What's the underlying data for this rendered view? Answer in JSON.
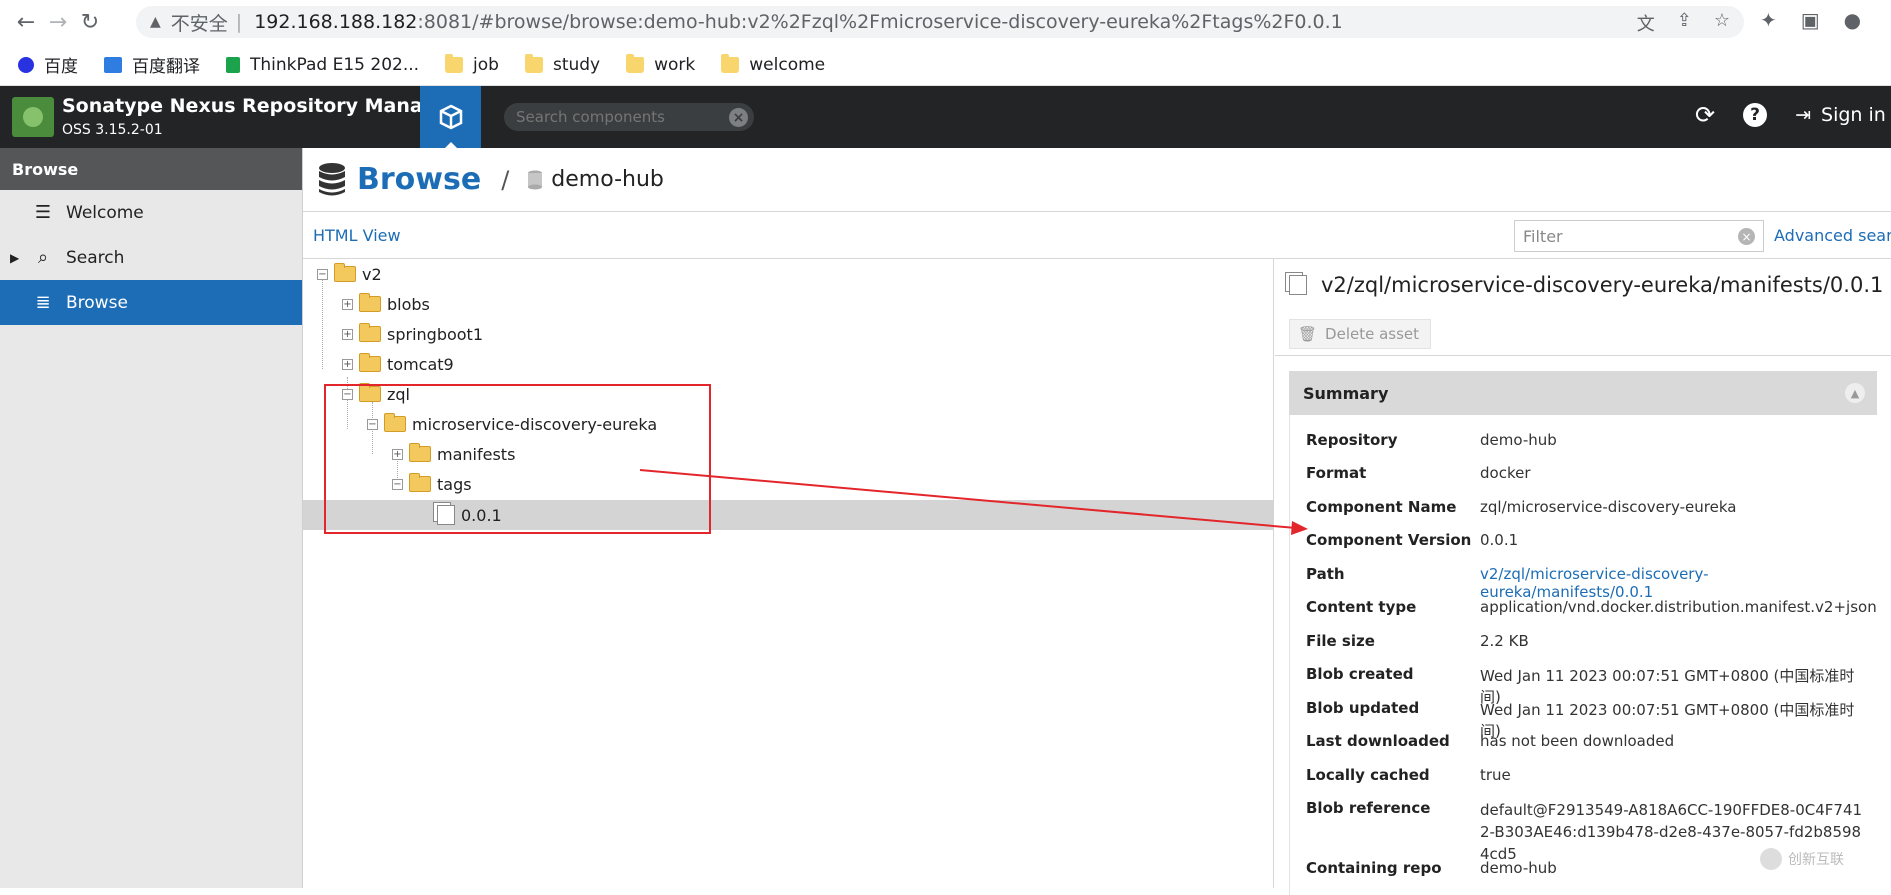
{
  "browser": {
    "insecure_label": "不安全",
    "url_host": "192.168.188.182",
    "url_path": ":8081/#browse/browse:demo-hub:v2%2Fzql%2Fmicroservice-discovery-eureka%2Ftags%2F0.0.1"
  },
  "bookmarks": [
    {
      "label": "百度",
      "color": "#2932e1"
    },
    {
      "label": "百度翻译",
      "color": "#2f7de1"
    },
    {
      "label": "ThinkPad E15 202...",
      "color": "#1aa34a"
    },
    {
      "label": "job",
      "color": "#f8d66d"
    },
    {
      "label": "study",
      "color": "#f8d66d"
    },
    {
      "label": "work",
      "color": "#f8d66d"
    },
    {
      "label": "welcome",
      "color": "#f8d66d"
    }
  ],
  "header": {
    "title": "Sonatype Nexus Repository Manager",
    "version": "OSS 3.15.2-01",
    "search_placeholder": "Search components",
    "signin_label": "Sign in"
  },
  "leftnav": {
    "section": "Browse",
    "items": [
      {
        "label": "Welcome",
        "icon": "list-icon"
      },
      {
        "label": "Search",
        "icon": "search-icon"
      },
      {
        "label": "Browse",
        "icon": "database-icon"
      }
    ]
  },
  "breadcrumb": {
    "root": "Browse",
    "separator": "/",
    "repo": "demo-hub"
  },
  "toolbar": {
    "html_view": "HTML View",
    "filter_placeholder": "Filter",
    "advanced_search": "Advanced search"
  },
  "tree": {
    "v2": "v2",
    "blobs": "blobs",
    "springboot1": "springboot1",
    "tomcat9": "tomcat9",
    "zql": "zql",
    "eureka": "microservice-discovery-eureka",
    "manifests": "manifests",
    "tags": "tags",
    "tag_001": "0.0.1"
  },
  "detail": {
    "title": "v2/zql/microservice-discovery-eureka/manifests/0.0.1",
    "delete_label": "Delete asset",
    "summary_label": "Summary",
    "rows": [
      {
        "k": "Repository",
        "v": "demo-hub"
      },
      {
        "k": "Format",
        "v": "docker"
      },
      {
        "k": "Component Name",
        "v": "zql/microservice-discovery-eureka"
      },
      {
        "k": "Component Version",
        "v": "0.0.1"
      },
      {
        "k": "Path",
        "v": "v2/zql/microservice-discovery-eureka/manifests/0.0.1"
      },
      {
        "k": "Content type",
        "v": "application/vnd.docker.distribution.manifest.v2+json"
      },
      {
        "k": "File size",
        "v": "2.2 KB"
      },
      {
        "k": "Blob created",
        "v": "Wed Jan 11 2023 00:07:51 GMT+0800 (中国标准时间)"
      },
      {
        "k": "Blob updated",
        "v": "Wed Jan 11 2023 00:07:51 GMT+0800 (中国标准时间)"
      },
      {
        "k": "Last downloaded",
        "v": "has not been downloaded"
      },
      {
        "k": "Locally cached",
        "v": "true"
      },
      {
        "k": "Blob reference",
        "v": "default@F2913549-A818A6CC-190FFDE8-0C4F7412-B303AE46:d139b478-d2e8-437e-8057-fd2b85984cd5"
      },
      {
        "k": "Containing repo",
        "v": "demo-hub"
      }
    ]
  },
  "watermark": "创新互联",
  "colors": {
    "nexus_header": "#222426",
    "accent_blue": "#1c6db6",
    "highlight_red": "#e3262b"
  }
}
